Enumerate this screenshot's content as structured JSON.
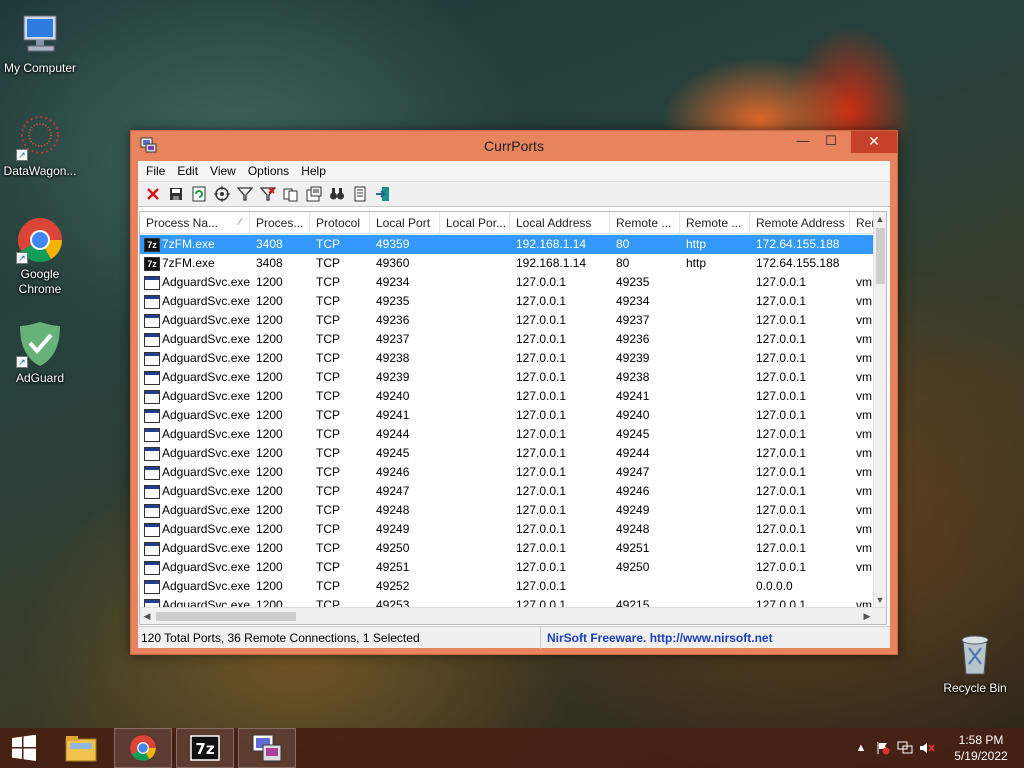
{
  "desktop": {
    "icons": [
      {
        "label": "My Computer"
      },
      {
        "label": "DataWagon..."
      },
      {
        "label": "Google Chrome"
      },
      {
        "label": "AdGuard"
      },
      {
        "label": "Recycle Bin"
      }
    ]
  },
  "window": {
    "title": "CurrPorts",
    "controls": {
      "minimize": "—",
      "maximize": "☐",
      "close": "✕"
    },
    "menu": [
      "File",
      "Edit",
      "View",
      "Options",
      "Help"
    ],
    "toolbar": [
      "delete-icon",
      "save-icon",
      "refresh-icon",
      "target-icon",
      "filter-icon",
      "filter-remove-icon",
      "copy-icon",
      "properties-icon",
      "find-icon",
      "html-report-icon",
      "exit-icon"
    ],
    "columns": [
      "Process Na...",
      "Proces...",
      "Protocol",
      "Local Port",
      "Local Por...",
      "Local Address",
      "Remote ...",
      "Remote ...",
      "Remote Address",
      "Rem"
    ],
    "rows": [
      [
        "7zFM.exe",
        "3408",
        "TCP",
        "49359",
        "",
        "192.168.1.14",
        "80",
        "http",
        "172.64.155.188",
        ""
      ],
      [
        "7zFM.exe",
        "3408",
        "TCP",
        "49360",
        "",
        "192.168.1.14",
        "80",
        "http",
        "172.64.155.188",
        ""
      ],
      [
        "AdguardSvc.exe",
        "1200",
        "TCP",
        "49234",
        "",
        "127.0.0.1",
        "49235",
        "",
        "127.0.0.1",
        "vm"
      ],
      [
        "AdguardSvc.exe",
        "1200",
        "TCP",
        "49235",
        "",
        "127.0.0.1",
        "49234",
        "",
        "127.0.0.1",
        "vm"
      ],
      [
        "AdguardSvc.exe",
        "1200",
        "TCP",
        "49236",
        "",
        "127.0.0.1",
        "49237",
        "",
        "127.0.0.1",
        "vm"
      ],
      [
        "AdguardSvc.exe",
        "1200",
        "TCP",
        "49237",
        "",
        "127.0.0.1",
        "49236",
        "",
        "127.0.0.1",
        "vm"
      ],
      [
        "AdguardSvc.exe",
        "1200",
        "TCP",
        "49238",
        "",
        "127.0.0.1",
        "49239",
        "",
        "127.0.0.1",
        "vm"
      ],
      [
        "AdguardSvc.exe",
        "1200",
        "TCP",
        "49239",
        "",
        "127.0.0.1",
        "49238",
        "",
        "127.0.0.1",
        "vm"
      ],
      [
        "AdguardSvc.exe",
        "1200",
        "TCP",
        "49240",
        "",
        "127.0.0.1",
        "49241",
        "",
        "127.0.0.1",
        "vm"
      ],
      [
        "AdguardSvc.exe",
        "1200",
        "TCP",
        "49241",
        "",
        "127.0.0.1",
        "49240",
        "",
        "127.0.0.1",
        "vm"
      ],
      [
        "AdguardSvc.exe",
        "1200",
        "TCP",
        "49244",
        "",
        "127.0.0.1",
        "49245",
        "",
        "127.0.0.1",
        "vm"
      ],
      [
        "AdguardSvc.exe",
        "1200",
        "TCP",
        "49245",
        "",
        "127.0.0.1",
        "49244",
        "",
        "127.0.0.1",
        "vm"
      ],
      [
        "AdguardSvc.exe",
        "1200",
        "TCP",
        "49246",
        "",
        "127.0.0.1",
        "49247",
        "",
        "127.0.0.1",
        "vm"
      ],
      [
        "AdguardSvc.exe",
        "1200",
        "TCP",
        "49247",
        "",
        "127.0.0.1",
        "49246",
        "",
        "127.0.0.1",
        "vm"
      ],
      [
        "AdguardSvc.exe",
        "1200",
        "TCP",
        "49248",
        "",
        "127.0.0.1",
        "49249",
        "",
        "127.0.0.1",
        "vm"
      ],
      [
        "AdguardSvc.exe",
        "1200",
        "TCP",
        "49249",
        "",
        "127.0.0.1",
        "49248",
        "",
        "127.0.0.1",
        "vm"
      ],
      [
        "AdguardSvc.exe",
        "1200",
        "TCP",
        "49250",
        "",
        "127.0.0.1",
        "49251",
        "",
        "127.0.0.1",
        "vm"
      ],
      [
        "AdguardSvc.exe",
        "1200",
        "TCP",
        "49251",
        "",
        "127.0.0.1",
        "49250",
        "",
        "127.0.0.1",
        "vm"
      ],
      [
        "AdguardSvc.exe",
        "1200",
        "TCP",
        "49252",
        "",
        "127.0.0.1",
        "",
        "",
        "0.0.0.0",
        ""
      ],
      [
        "AdguardSvc.exe",
        "1200",
        "TCP",
        "49253",
        "",
        "127.0.0.1",
        "49215",
        "",
        "127.0.0.1",
        "vm"
      ]
    ],
    "selected_row": 0,
    "status": {
      "summary": "120 Total Ports, 36 Remote Connections, 1 Selected",
      "credit": "NirSoft Freeware.  http://www.nirsoft.net"
    }
  },
  "taskbar": {
    "apps": [
      "file-explorer-icon",
      "chrome-icon",
      "7zip-icon",
      "currports-icon"
    ],
    "clock": {
      "time": "1:58 PM",
      "date": "5/19/2022"
    }
  },
  "colors": {
    "selection": "#3399ff",
    "title_frame": "#e8845d",
    "close_button": "#c7402a",
    "nirsoft_link": "#1a3fb8"
  }
}
